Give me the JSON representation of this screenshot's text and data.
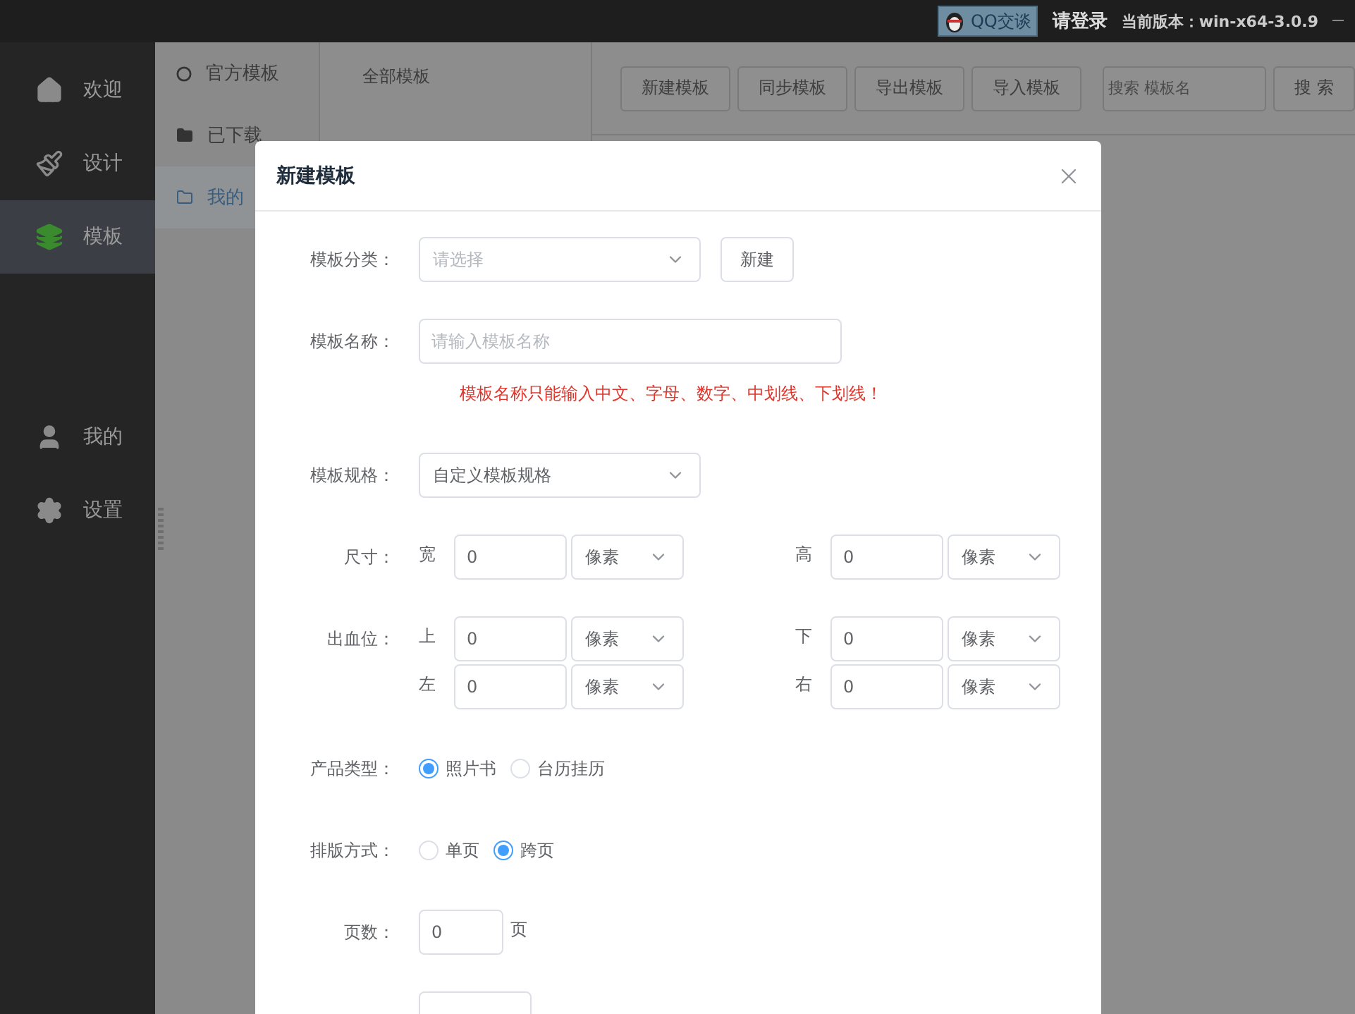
{
  "topbar": {
    "chat_button": "QQ交谈",
    "login": "请登录",
    "version": "当前版本：win-x64-3.0.9"
  },
  "sidebar": {
    "items": [
      {
        "label": "欢迎",
        "selected": false
      },
      {
        "label": "设计",
        "selected": false
      },
      {
        "label": "模板",
        "selected": true
      },
      {
        "label": "我的",
        "selected": false
      },
      {
        "label": "设置",
        "selected": false
      }
    ]
  },
  "subnav": {
    "items": [
      {
        "label": "官方模板",
        "selected": false
      },
      {
        "label": "已下载",
        "selected": false
      },
      {
        "label": "我的",
        "selected": true
      }
    ]
  },
  "category": "全部模板",
  "toolbar": {
    "buttons": [
      "新建模板",
      "同步模板",
      "导出模板",
      "导入模板"
    ],
    "search": {
      "placeholder": "搜索 模板名"
    },
    "search_button": "搜 索"
  },
  "dialog": {
    "title": "新建模板",
    "rows": [
      {
        "kind": "select",
        "label": "模板分类：",
        "placeholder": "请选择",
        "button": "新建"
      },
      {
        "kind": "input",
        "label": "模板名称：",
        "placeholder": "请输入模板名称",
        "error": "模板名称只能输入中文、字母、数字、中划线、下划线！"
      },
      {
        "kind": "select",
        "label": "模板规格：",
        "value": "自定义模板规格"
      },
      {
        "kind": "measures",
        "label": "尺寸：",
        "lines": [
          [
            {
              "side": "宽",
              "value": "0",
              "unit": "像素"
            },
            {
              "side": "高",
              "value": "0",
              "unit": "像素"
            }
          ]
        ]
      },
      {
        "kind": "measures",
        "label": "出血位：",
        "lines": [
          [
            {
              "side": "上",
              "value": "0",
              "unit": "像素"
            },
            {
              "side": "下",
              "value": "0",
              "unit": "像素"
            }
          ],
          [
            {
              "side": "左",
              "value": "0",
              "unit": "像素"
            },
            {
              "side": "右",
              "value": "0",
              "unit": "像素"
            }
          ]
        ]
      },
      {
        "kind": "radios",
        "label": "产品类型：",
        "options": [
          {
            "label": "照片书",
            "selected": true
          },
          {
            "label": "台历挂历",
            "selected": false
          }
        ]
      },
      {
        "kind": "radios",
        "label": "排版方式：",
        "options": [
          {
            "label": "单页",
            "selected": false
          },
          {
            "label": "跨页",
            "selected": true
          }
        ]
      },
      {
        "kind": "count",
        "label": "页数：",
        "value": "0",
        "unit": "页"
      },
      {
        "kind": "upload"
      }
    ]
  }
}
